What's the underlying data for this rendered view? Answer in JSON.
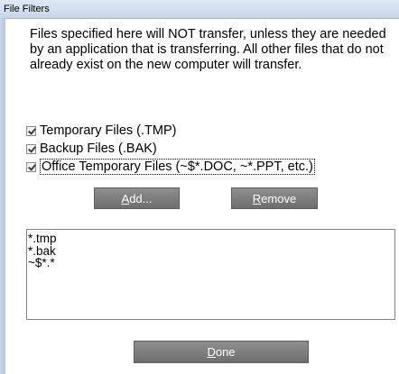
{
  "window": {
    "title": "File Filters"
  },
  "description": "Files specified here will NOT transfer, unless they are needed by an application that is transferring. All other files that do not already exist on the new computer will transfer.",
  "filters": [
    {
      "label": "Temporary Files (.TMP)",
      "checked": true
    },
    {
      "label": "Backup Files (.BAK)",
      "checked": true
    },
    {
      "label": "Office Temporary Files (~$*.DOC, ~*.PPT, etc.)",
      "checked": true
    }
  ],
  "buttons": {
    "add": "Add...",
    "remove": "Remove",
    "done": "Done"
  },
  "patterns": [
    "*.tmp",
    "*.bak",
    "~$*.*"
  ],
  "colors": {
    "button": "#7d7d7d",
    "titlebar": "#d2dff0"
  }
}
